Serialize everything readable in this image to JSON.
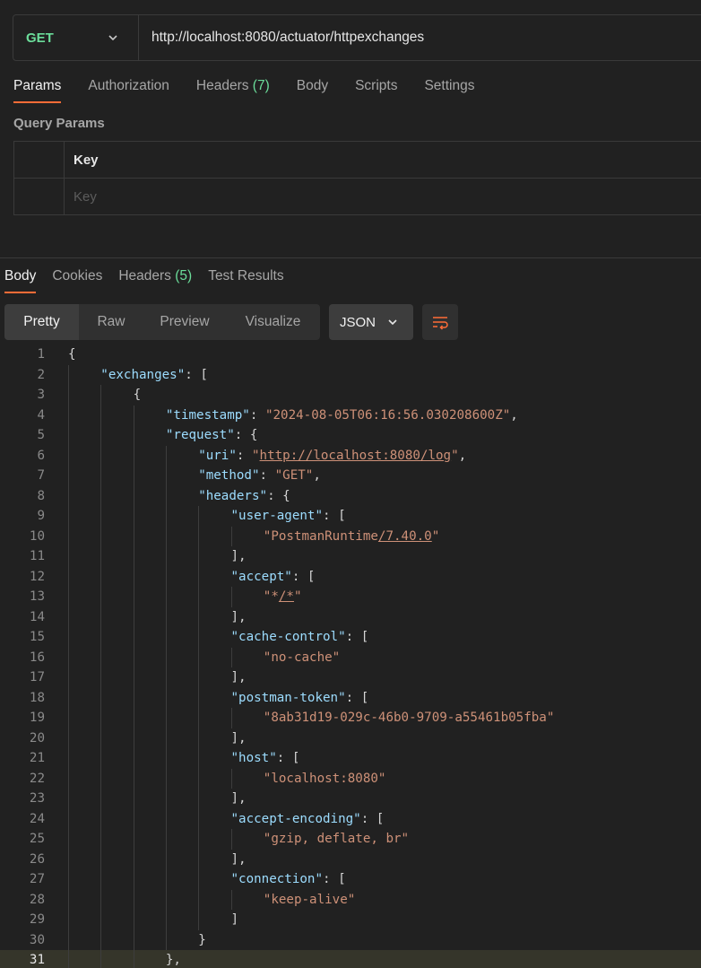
{
  "request": {
    "method": "GET",
    "url": "http://localhost:8080/actuator/httpexchanges"
  },
  "request_tabs": [
    {
      "label": "Params",
      "count": "",
      "active": true
    },
    {
      "label": "Authorization",
      "count": "",
      "active": false
    },
    {
      "label": "Headers",
      "count": "(7)",
      "active": false
    },
    {
      "label": "Body",
      "count": "",
      "active": false
    },
    {
      "label": "Scripts",
      "count": "",
      "active": false
    },
    {
      "label": "Settings",
      "count": "",
      "active": false
    }
  ],
  "query_params": {
    "title": "Query Params",
    "column_key": "Key",
    "key_placeholder": "Key"
  },
  "response_tabs": [
    {
      "label": "Body",
      "count": "",
      "active": true
    },
    {
      "label": "Cookies",
      "count": "",
      "active": false
    },
    {
      "label": "Headers",
      "count": "(5)",
      "active": false
    },
    {
      "label": "Test Results",
      "count": "",
      "active": false
    }
  ],
  "view_modes": [
    "Pretty",
    "Raw",
    "Preview",
    "Visualize"
  ],
  "active_view_mode": "Pretty",
  "format": "JSON",
  "icons": {
    "method_dropdown": "chevron-down-icon",
    "format_dropdown": "chevron-down-icon",
    "wrap": "wrap-lines-icon"
  },
  "colors": {
    "accent": "#ff6c37",
    "method_get": "#6bdd9a",
    "json_key": "#9cdcfe",
    "json_string": "#ce9178"
  },
  "code_lines": [
    {
      "n": "1",
      "indent": 0,
      "parts": [
        [
          "p",
          "{"
        ]
      ]
    },
    {
      "n": "2",
      "indent": 1,
      "parts": [
        [
          "k",
          "\"exchanges\""
        ],
        [
          "p",
          ": ["
        ]
      ]
    },
    {
      "n": "3",
      "indent": 2,
      "parts": [
        [
          "p",
          "{"
        ]
      ]
    },
    {
      "n": "4",
      "indent": 3,
      "parts": [
        [
          "k",
          "\"timestamp\""
        ],
        [
          "p",
          ": "
        ],
        [
          "s",
          "\"2024-08-05T06:16:56.030208600Z\""
        ],
        [
          "p",
          ","
        ]
      ]
    },
    {
      "n": "5",
      "indent": 3,
      "parts": [
        [
          "k",
          "\"request\""
        ],
        [
          "p",
          ": {"
        ]
      ]
    },
    {
      "n": "6",
      "indent": 4,
      "parts": [
        [
          "k",
          "\"uri\""
        ],
        [
          "p",
          ": "
        ],
        [
          "s",
          "\""
        ],
        [
          "su",
          "http://localhost:8080/log"
        ],
        [
          "s",
          "\""
        ],
        [
          "p",
          ","
        ]
      ]
    },
    {
      "n": "7",
      "indent": 4,
      "parts": [
        [
          "k",
          "\"method\""
        ],
        [
          "p",
          ": "
        ],
        [
          "s",
          "\"GET\""
        ],
        [
          "p",
          ","
        ]
      ]
    },
    {
      "n": "8",
      "indent": 4,
      "parts": [
        [
          "k",
          "\"headers\""
        ],
        [
          "p",
          ": {"
        ]
      ]
    },
    {
      "n": "9",
      "indent": 5,
      "parts": [
        [
          "k",
          "\"user-agent\""
        ],
        [
          "p",
          ": ["
        ]
      ]
    },
    {
      "n": "10",
      "indent": 6,
      "parts": [
        [
          "s",
          "\"PostmanRuntime"
        ],
        [
          "su",
          "/7.40.0"
        ],
        [
          "s",
          "\""
        ]
      ]
    },
    {
      "n": "11",
      "indent": 5,
      "parts": [
        [
          "p",
          "],"
        ]
      ]
    },
    {
      "n": "12",
      "indent": 5,
      "parts": [
        [
          "k",
          "\"accept\""
        ],
        [
          "p",
          ": ["
        ]
      ]
    },
    {
      "n": "13",
      "indent": 6,
      "parts": [
        [
          "s",
          "\"*"
        ],
        [
          "su",
          "/*"
        ],
        [
          "s",
          "\""
        ]
      ]
    },
    {
      "n": "14",
      "indent": 5,
      "parts": [
        [
          "p",
          "],"
        ]
      ]
    },
    {
      "n": "15",
      "indent": 5,
      "parts": [
        [
          "k",
          "\"cache-control\""
        ],
        [
          "p",
          ": ["
        ]
      ]
    },
    {
      "n": "16",
      "indent": 6,
      "parts": [
        [
          "s",
          "\"no-cache\""
        ]
      ]
    },
    {
      "n": "17",
      "indent": 5,
      "parts": [
        [
          "p",
          "],"
        ]
      ]
    },
    {
      "n": "18",
      "indent": 5,
      "parts": [
        [
          "k",
          "\"postman-token\""
        ],
        [
          "p",
          ": ["
        ]
      ]
    },
    {
      "n": "19",
      "indent": 6,
      "parts": [
        [
          "s",
          "\"8ab31d19-029c-46b0-9709-a55461b05fba\""
        ]
      ]
    },
    {
      "n": "20",
      "indent": 5,
      "parts": [
        [
          "p",
          "],"
        ]
      ]
    },
    {
      "n": "21",
      "indent": 5,
      "parts": [
        [
          "k",
          "\"host\""
        ],
        [
          "p",
          ": ["
        ]
      ]
    },
    {
      "n": "22",
      "indent": 6,
      "parts": [
        [
          "s",
          "\"localhost:8080\""
        ]
      ]
    },
    {
      "n": "23",
      "indent": 5,
      "parts": [
        [
          "p",
          "],"
        ]
      ]
    },
    {
      "n": "24",
      "indent": 5,
      "parts": [
        [
          "k",
          "\"accept-encoding\""
        ],
        [
          "p",
          ": ["
        ]
      ]
    },
    {
      "n": "25",
      "indent": 6,
      "parts": [
        [
          "s",
          "\"gzip, deflate, br\""
        ]
      ]
    },
    {
      "n": "26",
      "indent": 5,
      "parts": [
        [
          "p",
          "],"
        ]
      ]
    },
    {
      "n": "27",
      "indent": 5,
      "parts": [
        [
          "k",
          "\"connection\""
        ],
        [
          "p",
          ": ["
        ]
      ]
    },
    {
      "n": "28",
      "indent": 6,
      "parts": [
        [
          "s",
          "\"keep-alive\""
        ]
      ]
    },
    {
      "n": "29",
      "indent": 5,
      "parts": [
        [
          "p",
          "]"
        ]
      ]
    },
    {
      "n": "30",
      "indent": 4,
      "parts": [
        [
          "p",
          "}"
        ]
      ]
    },
    {
      "n": "31",
      "indent": 3,
      "parts": [
        [
          "p",
          "},"
        ]
      ],
      "current": true
    }
  ]
}
